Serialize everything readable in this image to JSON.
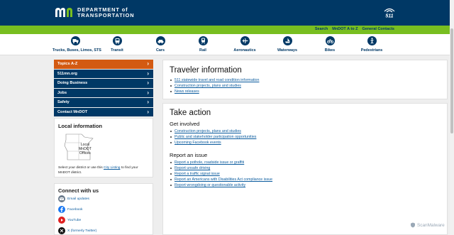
{
  "header": {
    "org_line1": "DEPARTMENT of",
    "org_line2": "TRANSPORTATION",
    "badge": "511"
  },
  "utility_links": [
    "Search",
    "MnDOT A to Z",
    "General Contacts"
  ],
  "transport_nav": [
    {
      "label": "Trucks, Buses, Limos, STS",
      "icon": "truck-icon"
    },
    {
      "label": "Transit",
      "icon": "bus-icon"
    },
    {
      "label": "Cars",
      "icon": "car-icon"
    },
    {
      "label": "Rail",
      "icon": "train-icon"
    },
    {
      "label": "Aeronautics",
      "icon": "plane-icon"
    },
    {
      "label": "Waterways",
      "icon": "boat-icon"
    },
    {
      "label": "Bikes",
      "icon": "bike-icon"
    },
    {
      "label": "Pedestrians",
      "icon": "pedestrian-icon"
    }
  ],
  "side_menu": [
    {
      "label": "Topics A-Z",
      "active": true
    },
    {
      "label": "511mn.org"
    },
    {
      "label": "Doing Business"
    },
    {
      "label": "Jobs"
    },
    {
      "label": "Safety"
    },
    {
      "label": "Contact MnDOT"
    }
  ],
  "local_info": {
    "title": "Local information",
    "map_label_1": "Local",
    "map_label_2": "MnDOT",
    "map_label_3": "Offices",
    "text_before": "Select your district or use this",
    "link": "City Listing",
    "text_after": "to find your MnDOT district."
  },
  "connect": {
    "title": "Connect with us",
    "items": [
      {
        "label": "Email updates",
        "color": "#6b7b8c"
      },
      {
        "label": "Facebook",
        "color": "#1877f2"
      },
      {
        "label": "YouTube",
        "color": "#e02020"
      },
      {
        "label": "X (formerly Twitter)",
        "color": "#111111"
      }
    ]
  },
  "traveler": {
    "title": "Traveler information",
    "links": [
      "511 statewide travel and road condition information",
      "Construction projects, plans and studies",
      "News releases"
    ]
  },
  "take_action": {
    "title": "Take action",
    "involved_title": "Get involved",
    "involved_links": [
      "Construction projects, plans and studies",
      "Public and stakeholder participation opportunities",
      "Upcoming Facebook events"
    ],
    "report_title": "Report an issue",
    "report_links": [
      "Report a pothole, roadside issue or graffiti",
      "Report unsafe driving",
      "Report a traffic signal issue",
      "Report an Americans with Disabilities Act compliance issue",
      "Report wrongdoing or questionable activity"
    ]
  },
  "watermark": "ScanMalware",
  "colors": {
    "navy": "#003865",
    "green": "#78be20",
    "orange": "#d35a12",
    "link": "#0a5b9e"
  }
}
